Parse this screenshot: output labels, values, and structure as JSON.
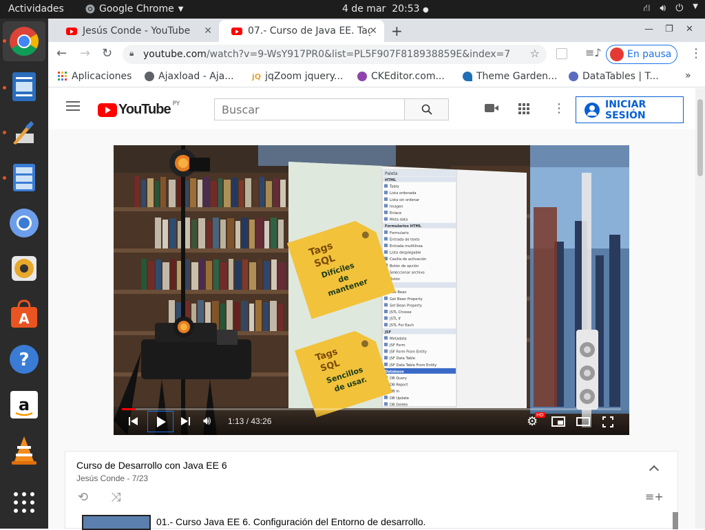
{
  "system": {
    "activities": "Actividades",
    "app_name": "Google Chrome",
    "date": "4 de mar",
    "time": "20:53"
  },
  "tabs": [
    {
      "title": "Jesús Conde - YouTube",
      "active": false
    },
    {
      "title": "07.- Curso de Java EE. Tag",
      "active": true
    }
  ],
  "toolbar": {
    "url_host": "youtube.com",
    "url_path": "/watch?v=9-WsY917PR0&list=PL5F907F818938859E&index=7",
    "profile_label": "En pausa"
  },
  "bookmarks": [
    {
      "label": "Aplicaciones",
      "icon": "apps-grid-icon"
    },
    {
      "label": "Ajaxload - Aja...",
      "icon": "globe-icon"
    },
    {
      "label": "jqZoom jquery...",
      "icon": "jq-icon"
    },
    {
      "label": "CKEditor.com...",
      "icon": "ckeditor-icon"
    },
    {
      "label": "Theme Garden...",
      "icon": "theme-garden-icon"
    },
    {
      "label": "DataTables | T...",
      "icon": "datatables-icon"
    }
  ],
  "youtube": {
    "logo_text": "YouTube",
    "region": "PY",
    "search_placeholder": "Buscar",
    "signin_label": "INICIAR SESIÓN"
  },
  "video": {
    "time_current": "1:13",
    "time_total": "43:26",
    "progress_fraction": 0.028,
    "palette_title": "Paleta",
    "palette_items": [
      "HTML",
      "Tabla",
      "Lista ordenada",
      "Lista sin ordenar",
      "Imagen",
      "Enlace",
      "Meta data",
      "Formularios HTML",
      "Formulario",
      "Entrada de texto",
      "Entrada multilínea",
      "Lista desplegable",
      "Casilla de activación",
      "Botón de opción",
      "Seleccionar archivo",
      "Botón",
      "JSP",
      "Use Bean",
      "Get Bean Property",
      "Set Bean Property",
      "JSTL Choose",
      "JSTL If",
      "JSTL For Each",
      "JSF",
      "Metadata",
      "JSF Form",
      "JSF Form From Entity",
      "JSF Data Table",
      "JSF Data Table From Entity",
      "Database",
      "DB Query",
      "DB Report",
      "DB In",
      "DB Update",
      "DB Delete"
    ],
    "tag1_lines": [
      "Tags",
      "SQL",
      "Difíciles",
      "de",
      "mantener"
    ],
    "tag2_lines": [
      "Tags",
      "SQL",
      "Sencillos",
      "de usar."
    ],
    "hd_badge": "HD"
  },
  "playlist": {
    "title": "Curso de Desarrollo con Java EE 6",
    "subtitle": "Jesús Conde - 7/23",
    "first_item": "01.- Curso Java EE 6. Configuración del Entorno de desarrollo."
  },
  "colors": {
    "yt_red": "#ff0000",
    "link_blue": "#065fd4",
    "ubuntu_orange": "#e95420",
    "tag_yellow": "#f2c23a"
  }
}
